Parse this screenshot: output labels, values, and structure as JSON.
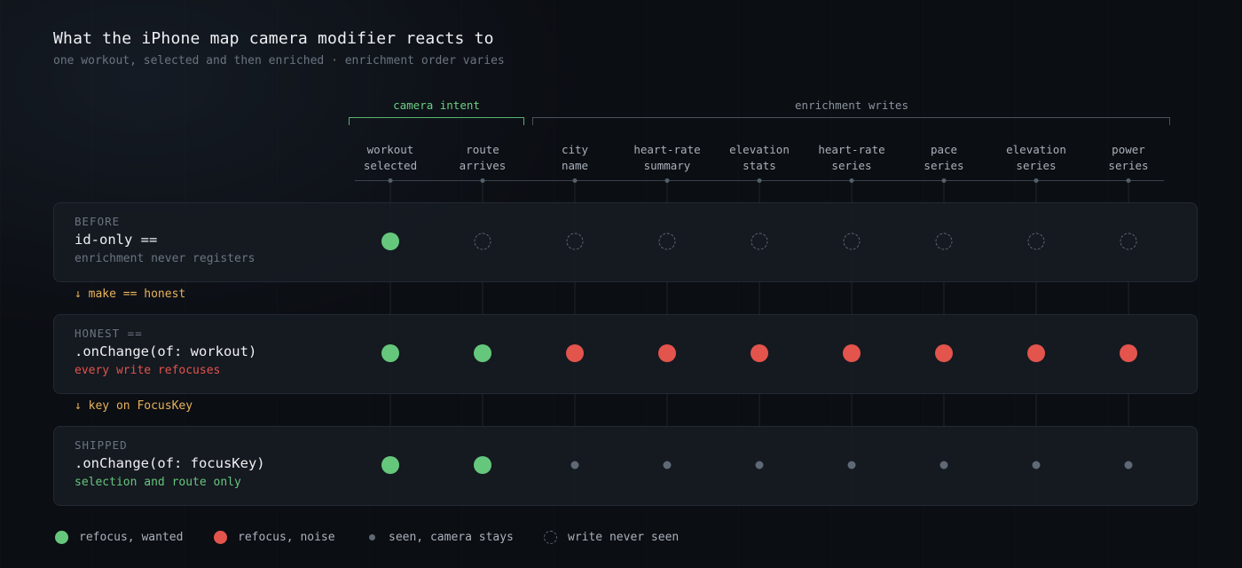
{
  "header": {
    "title": "What the iPhone map camera modifier reacts to",
    "subtitle": "one workout, selected and then enriched · enrichment order varies"
  },
  "groups": {
    "intent": "camera intent",
    "writes": "enrichment writes"
  },
  "columns": [
    {
      "line1": "workout",
      "line2": "selected",
      "group": "intent"
    },
    {
      "line1": "route",
      "line2": "arrives",
      "group": "intent"
    },
    {
      "line1": "city",
      "line2": "name",
      "group": "writes"
    },
    {
      "line1": "heart-rate",
      "line2": "summary",
      "group": "writes"
    },
    {
      "line1": "elevation",
      "line2": "stats",
      "group": "writes"
    },
    {
      "line1": "heart-rate",
      "line2": "series",
      "group": "writes"
    },
    {
      "line1": "pace",
      "line2": "series",
      "group": "writes"
    },
    {
      "line1": "elevation",
      "line2": "series",
      "group": "writes"
    },
    {
      "line1": "power",
      "line2": "series",
      "group": "writes"
    }
  ],
  "rows": [
    {
      "tag": "BEFORE",
      "code": "id-only ==",
      "note": "enrichment never registers",
      "note_color": "#6b7480",
      "states": [
        "wanted",
        "never",
        "never",
        "never",
        "never",
        "never",
        "never",
        "never",
        "never"
      ]
    },
    {
      "tag": "HONEST ==",
      "code": ".onChange(of: workout)",
      "note": "every write refocuses",
      "note_color": "#e2544c",
      "states": [
        "wanted",
        "wanted",
        "noise",
        "noise",
        "noise",
        "noise",
        "noise",
        "noise",
        "noise"
      ]
    },
    {
      "tag": "SHIPPED",
      "code": ".onChange(of: focusKey)",
      "note": "selection and route only",
      "note_color": "#65c77c",
      "states": [
        "wanted",
        "wanted",
        "seen",
        "seen",
        "seen",
        "seen",
        "seen",
        "seen",
        "seen"
      ]
    }
  ],
  "transitions": [
    "↓ make == honest",
    "↓ key on FocusKey"
  ],
  "legend": [
    {
      "state": "wanted",
      "label": "refocus, wanted"
    },
    {
      "state": "noise",
      "label": "refocus, noise"
    },
    {
      "state": "seen",
      "label": "seen, camera stays"
    },
    {
      "state": "never",
      "label": "write never seen"
    }
  ],
  "colors": {
    "wanted": "#65c77c",
    "noise": "#e2544c",
    "seen": "#5f6975",
    "accent_transition": "#e8b25c"
  }
}
